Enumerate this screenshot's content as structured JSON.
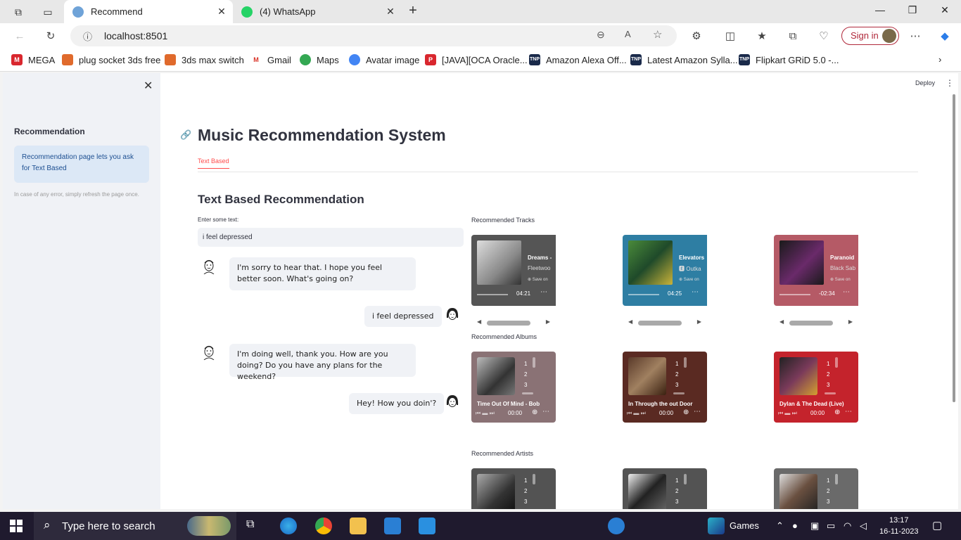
{
  "browser": {
    "tabs": [
      {
        "label": "Recommend",
        "active": true
      },
      {
        "label": "(4) WhatsApp",
        "active": false
      }
    ],
    "url": "localhost:8501",
    "sign_in_label": "Sign in",
    "bookmarks": [
      "MEGA",
      "plug socket 3ds free",
      "3ds max switch",
      "Gmail",
      "Maps",
      "Avatar image",
      "[JAVA][OCA Oracle...",
      "Amazon Alexa Off...",
      "Latest Amazon Sylla...",
      "Flipkart GRiD 5.0 -..."
    ]
  },
  "sidebar": {
    "title": "Recommendation",
    "info": "Recommendation page lets you ask for Text Based",
    "note": "In case of any error, simply refresh the page once."
  },
  "header": {
    "deploy_label": "Deploy"
  },
  "main": {
    "title": "Music Recommendation System",
    "tab_label": "Text Based",
    "subtitle": "Text Based Recommendation",
    "input_label": "Enter some text:",
    "input_value": "i feel depressed",
    "chat": [
      {
        "from": "bot",
        "text": "I'm sorry to hear that. I hope you feel better soon. What's going on?"
      },
      {
        "from": "user",
        "text": "i feel depressed"
      },
      {
        "from": "bot",
        "text": "I'm doing well, thank you. How are you doing? Do you have any plans for the weekend?"
      },
      {
        "from": "user",
        "text": "Hey! How you doin'?"
      }
    ],
    "tracks_label": "Recommended Tracks",
    "tracks": [
      {
        "name": "Dreams -",
        "artist": "Fleetwoo",
        "save": "Save on",
        "time": "04:21",
        "color": "#555555"
      },
      {
        "name": "Elevators",
        "artist": "Outka",
        "save": "Save on",
        "time": "04:25",
        "color": "#2e7ea3"
      },
      {
        "name": "Paranoid",
        "artist": "Black Sab",
        "save": "Save on",
        "time": "-02:34",
        "color": "#b55a66"
      }
    ],
    "albums_label": "Recommended Albums",
    "albums": [
      {
        "name": "Time Out Of Mind - Bob",
        "time": "00:00",
        "nums": [
          "1",
          "2",
          "3"
        ],
        "color": "#8a7275"
      },
      {
        "name": "In Through the out Door",
        "time": "00:00",
        "nums": [
          "1",
          "2",
          "3"
        ],
        "color": "#5a2a22"
      },
      {
        "name": "Dylan & The Dead (Live)",
        "time": "00:00",
        "nums": [
          "1",
          "2",
          "3"
        ],
        "color": "#c4232c"
      }
    ],
    "artists_label": "Recommended Artists",
    "artists": [
      {
        "nums": [
          "1",
          "2",
          "3"
        ],
        "color": "#535353"
      },
      {
        "nums": [
          "1",
          "2",
          "3"
        ],
        "color": "#535353"
      },
      {
        "nums": [
          "1",
          "2",
          "3"
        ],
        "color": "#6a6a6a"
      }
    ]
  },
  "taskbar": {
    "search_placeholder": "Type here to search",
    "games_label": "Games",
    "time": "13:17",
    "date": "16-11-2023"
  }
}
